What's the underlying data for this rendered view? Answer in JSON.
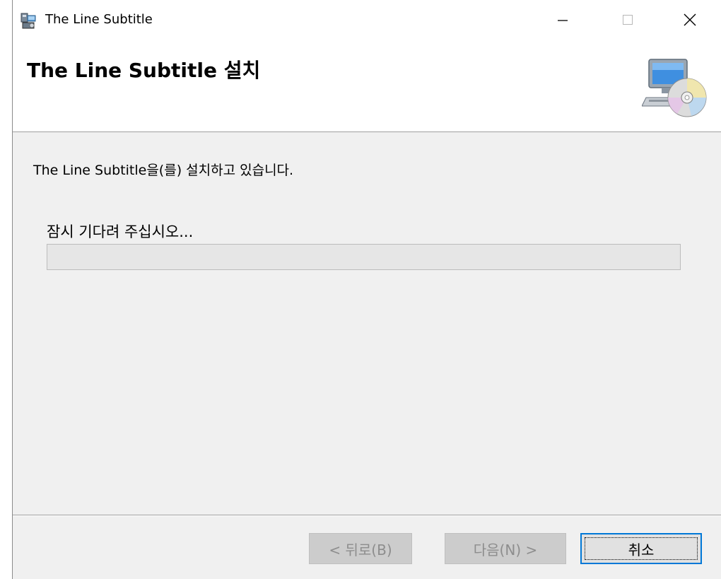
{
  "window": {
    "title": "The Line Subtitle"
  },
  "header": {
    "title": "The Line Subtitle 설치",
    "image": "setup-computer-cd-icon"
  },
  "body": {
    "status": "The Line Subtitle을(를) 설치하고 있습니다.",
    "wait_label": "잠시 기다려 주십시오...",
    "progress": 0
  },
  "buttons": {
    "back": "< 뒤로(B)",
    "next": "다음(N) >",
    "cancel": "취소"
  },
  "icons": {
    "app": "installer-package-icon",
    "minimize": "minimize-icon",
    "maximize": "maximize-icon",
    "close": "close-icon"
  },
  "colors": {
    "accent": "#0078d7",
    "progress": "#06b025"
  }
}
